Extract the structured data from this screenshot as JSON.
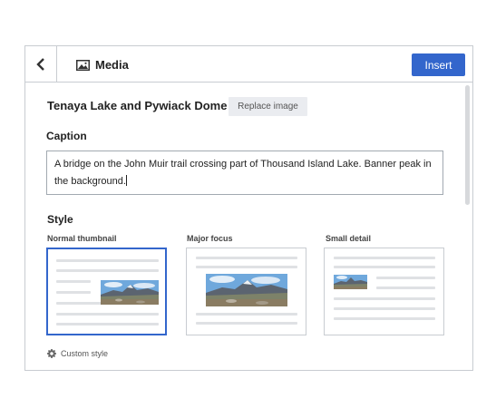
{
  "header": {
    "title": "Media",
    "insert_label": "Insert"
  },
  "image": {
    "title": "Tenaya Lake and Pywiack Dome",
    "replace_label": "Replace image"
  },
  "caption": {
    "label": "Caption",
    "value": "A bridge on the John Muir trail crossing part of Thousand Island Lake. Banner peak in the background."
  },
  "style": {
    "label": "Style",
    "options": [
      {
        "label": "Normal thumbnail",
        "selected": true
      },
      {
        "label": "Major focus",
        "selected": false
      },
      {
        "label": "Small detail",
        "selected": false
      }
    ],
    "custom_label": "Custom style"
  },
  "colors": {
    "accent": "#3366cc",
    "border": "#c8ccd1"
  },
  "icons": {
    "back": "chevron-left-icon",
    "media": "image-icon",
    "custom": "gear-icon"
  }
}
